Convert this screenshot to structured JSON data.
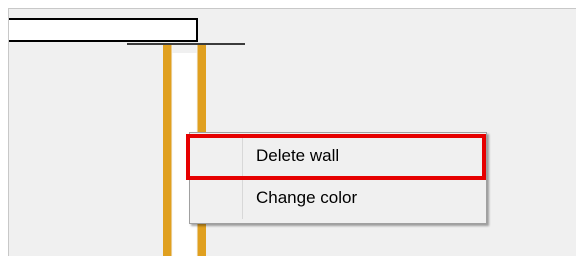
{
  "context_menu": {
    "items": [
      {
        "label": "Delete wall",
        "highlighted": true
      },
      {
        "label": "Change color",
        "highlighted": false
      }
    ]
  },
  "colors": {
    "canvas_background": "#f0f0f0",
    "wall_fill": "#ffffff",
    "wall_edge": "#000000",
    "selected_wall": "#e0a020",
    "highlight": "#e60000"
  },
  "icons": {
    "menu_gutter": "menu-gutter-line"
  }
}
